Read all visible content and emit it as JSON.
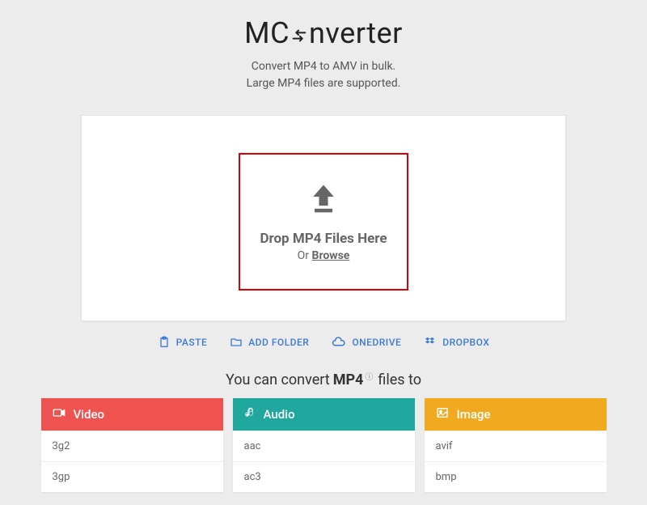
{
  "brand": {
    "prefix": "MC",
    "suffix": "nverter"
  },
  "subtitle": {
    "line1": "Convert MP4 to AMV in bulk.",
    "line2": "Large MP4 files are supported."
  },
  "dropzone": {
    "title": "Drop MP4 Files Here",
    "or": "Or ",
    "browse": "Browse"
  },
  "actions": {
    "paste": "PASTE",
    "add_folder": "ADD FOLDER",
    "onedrive": "ONEDRIVE",
    "dropbox": "DROPBOX"
  },
  "convert": {
    "prefix": "You can convert ",
    "format": "MP4",
    "suffix": " files to"
  },
  "categories": {
    "video": {
      "label": "Video",
      "items": [
        "3g2",
        "3gp"
      ]
    },
    "audio": {
      "label": "Audio",
      "items": [
        "aac",
        "ac3"
      ]
    },
    "image": {
      "label": "Image",
      "items": [
        "avif",
        "bmp"
      ]
    }
  }
}
